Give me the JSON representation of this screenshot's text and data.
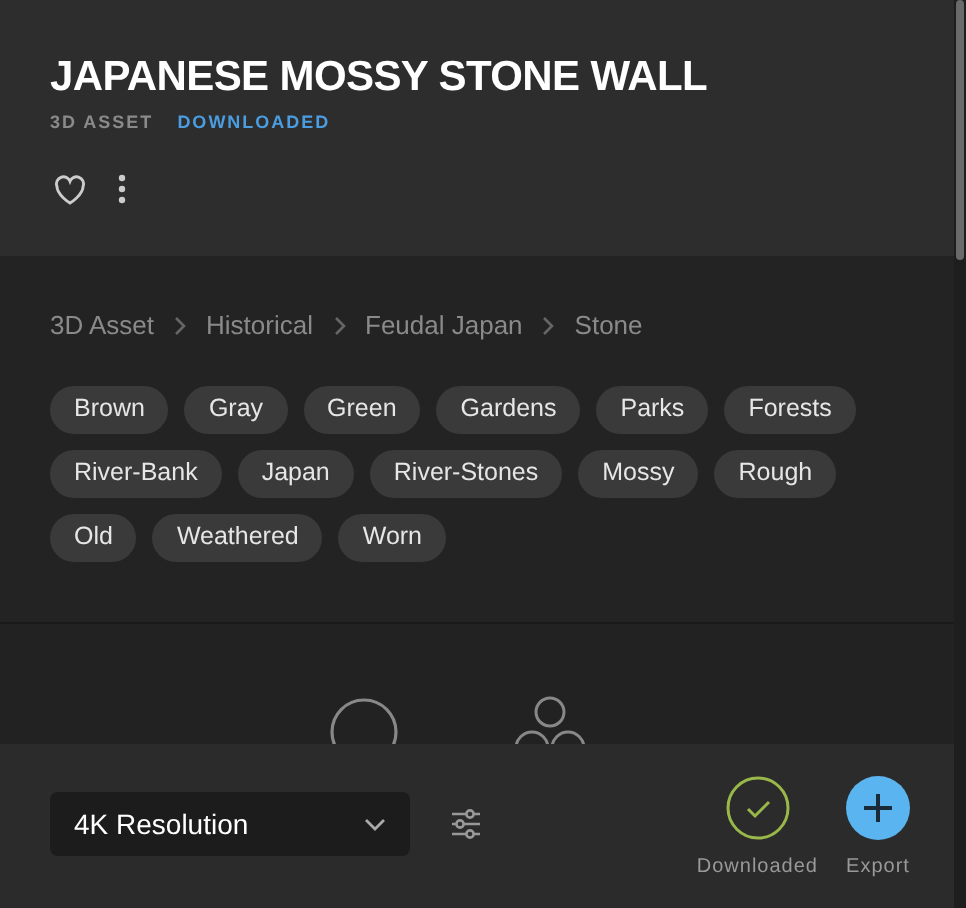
{
  "asset": {
    "title": "JAPANESE MOSSY STONE WALL",
    "type": "3D ASSET",
    "status": "DOWNLOADED",
    "favorite": false
  },
  "breadcrumbs": [
    "3D Asset",
    "Historical",
    "Feudal Japan",
    "Stone"
  ],
  "tags": [
    "Brown",
    "Gray",
    "Green",
    "Gardens",
    "Parks",
    "Forests",
    "River-Bank",
    "Japan",
    "River-Stones",
    "Mossy",
    "Rough",
    "Old",
    "Weathered",
    "Worn"
  ],
  "footer": {
    "resolution": "4K Resolution",
    "actions": [
      {
        "kind": "downloaded",
        "label": "Downloaded"
      },
      {
        "kind": "export",
        "label": "Export"
      }
    ]
  }
}
